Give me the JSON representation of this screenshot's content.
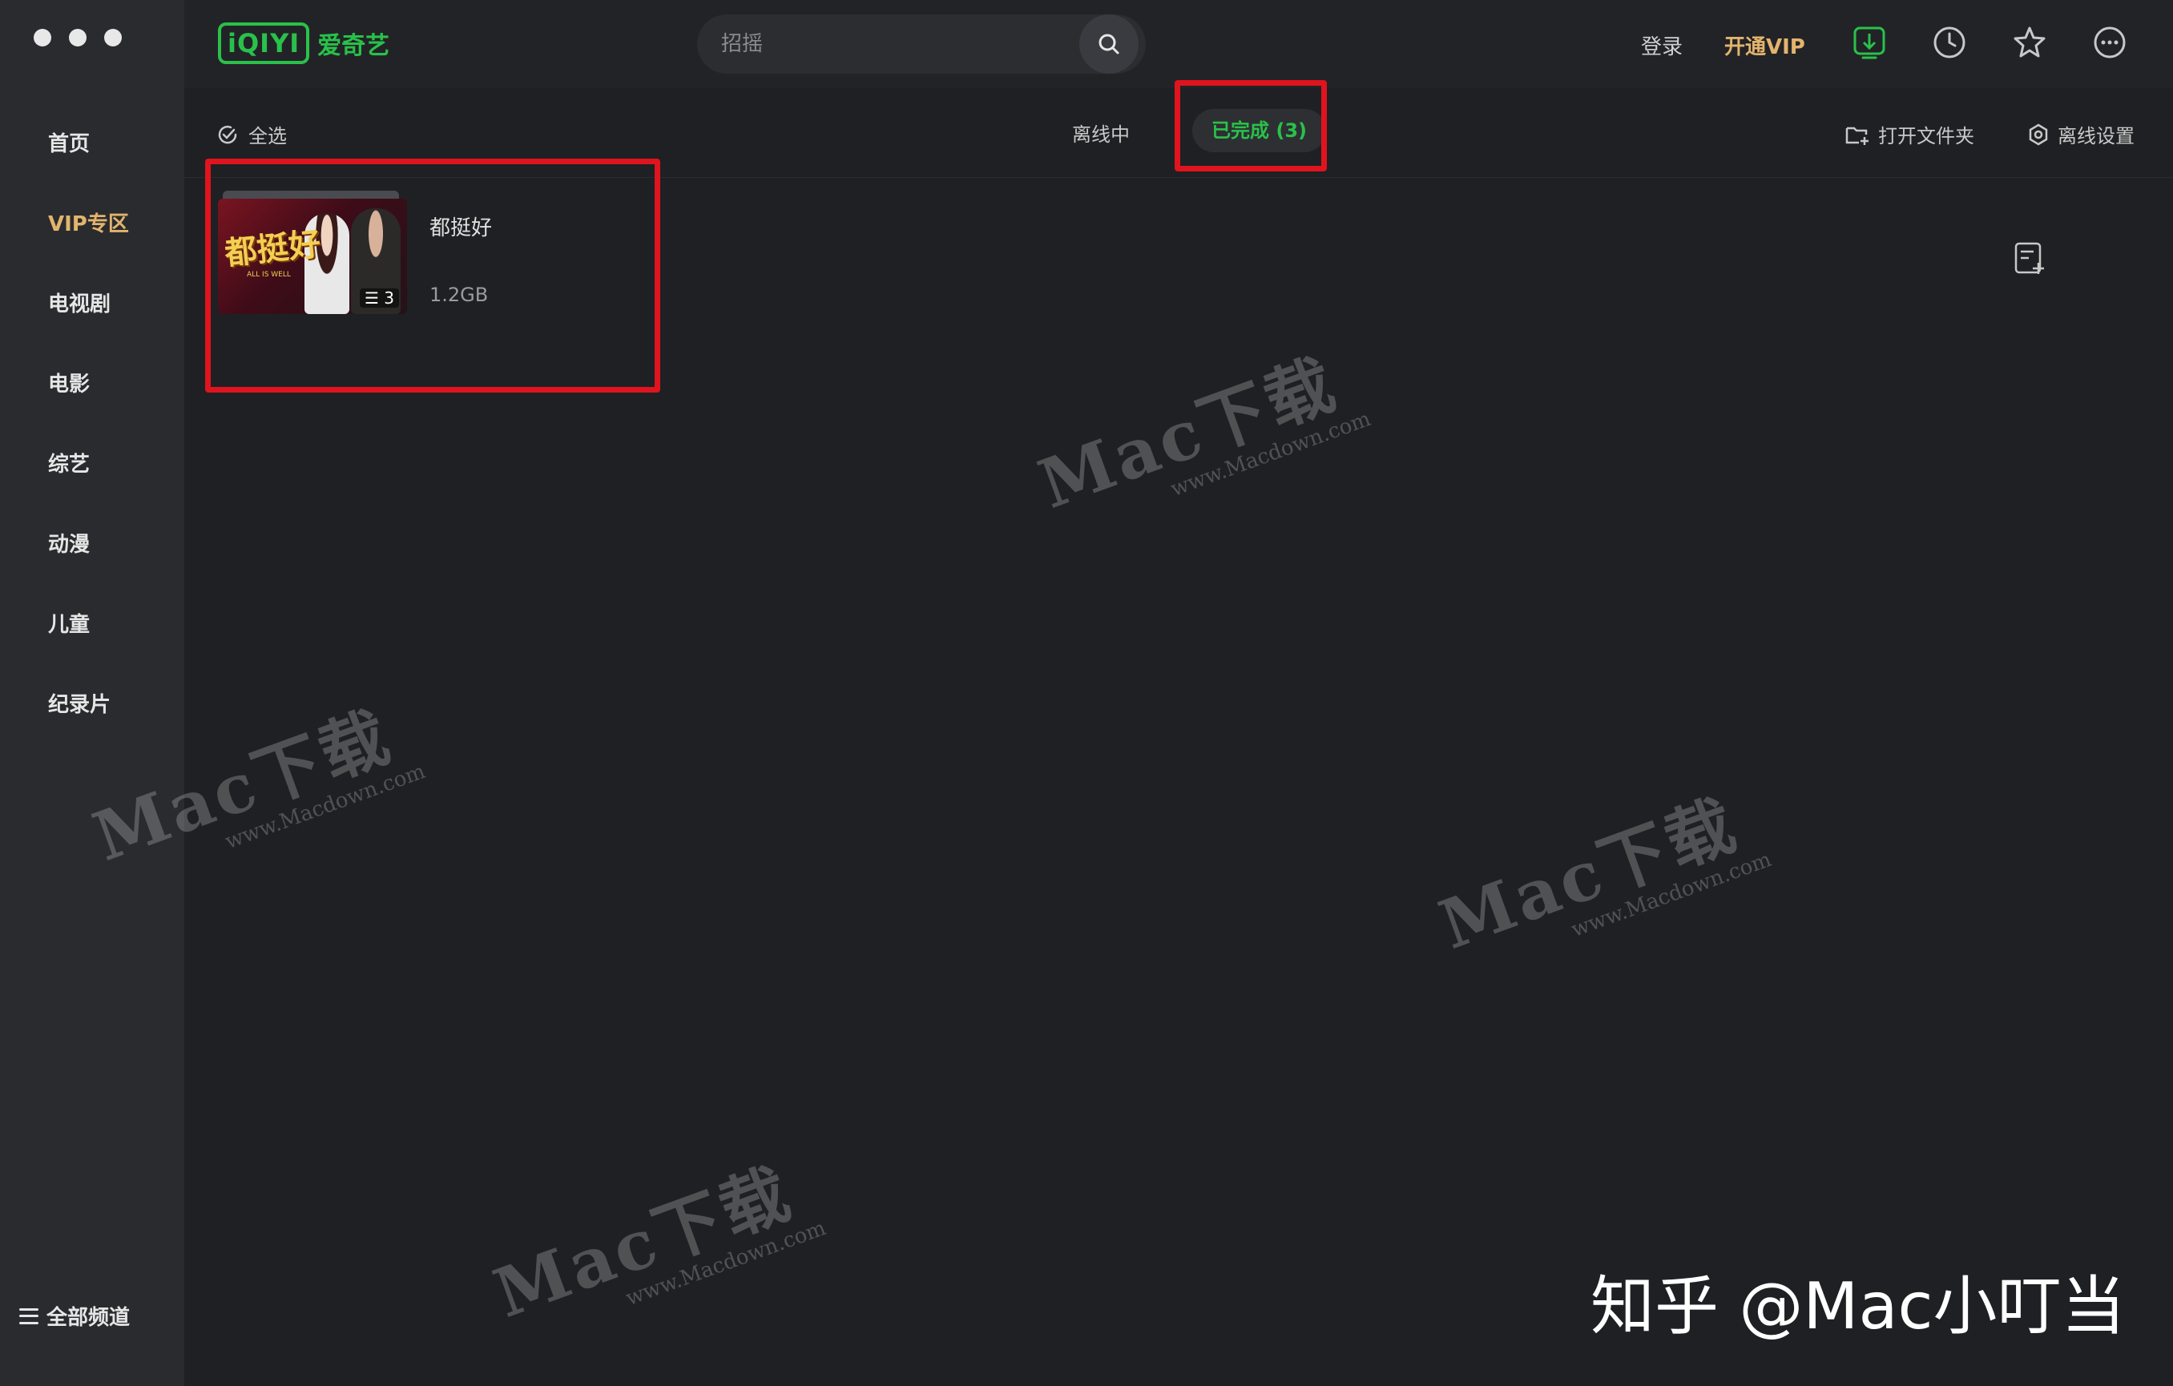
{
  "sidebar": {
    "items": [
      {
        "label": "首页"
      },
      {
        "label": "VIP专区"
      },
      {
        "label": "电视剧"
      },
      {
        "label": "电影"
      },
      {
        "label": "综艺"
      },
      {
        "label": "动漫"
      },
      {
        "label": "儿童"
      },
      {
        "label": "纪录片"
      }
    ],
    "all_channels_label": "全部频道"
  },
  "header": {
    "logo_box": "iQIYI",
    "logo_text": "爱奇艺",
    "search_placeholder": "招摇",
    "login_label": "登录",
    "vip_label": "开通VIP"
  },
  "subbar": {
    "select_all_label": "全选",
    "tabs": [
      {
        "label": "离线中"
      },
      {
        "label": "已完成 (3)"
      }
    ],
    "open_folder_label": "打开文件夹",
    "offline_settings_label": "离线设置"
  },
  "downloads": [
    {
      "title": "都挺好",
      "size": "1.2GB",
      "episode_count": "3",
      "poster_text": "都挺好",
      "poster_subtitle": "ALL IS WELL"
    }
  ],
  "watermark": {
    "brand": "Mac下载",
    "url": "www.Macdown.com"
  },
  "overlay_credit": "知乎 @Mac小叮当",
  "colors": {
    "accent_green": "#29c14a",
    "vip_gold": "#e2b46c",
    "highlight_red": "#e0141e",
    "background": "#1f2023",
    "sidebar": "#2a2b2f"
  },
  "icons": {
    "search": "search-icon",
    "download": "download-icon",
    "history": "clock-icon",
    "favorites": "star-icon",
    "more": "more-icon",
    "select_all": "check-circle-icon",
    "open_folder": "folder-plus-icon",
    "offline_settings": "gear-icon",
    "edit_list": "edit-list-icon"
  }
}
